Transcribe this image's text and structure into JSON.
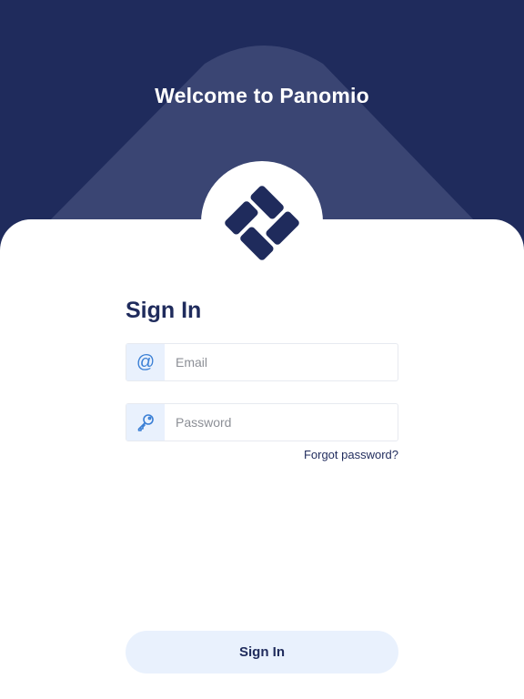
{
  "header": {
    "title": "Welcome to Panomio"
  },
  "logo": {
    "icon": "panomio-logo-icon"
  },
  "form": {
    "heading": "Sign In",
    "email": {
      "icon": "at-sign-icon",
      "icon_glyph": "@",
      "placeholder": "Email",
      "value": ""
    },
    "password": {
      "icon": "key-icon",
      "placeholder": "Password",
      "value": ""
    },
    "forgot_label": "Forgot password?",
    "submit_label": "Sign In"
  },
  "colors": {
    "brand_dark": "#1f2b5c",
    "beam": "#3a4573",
    "accent": "#3a7fd5",
    "button_bg": "#e9f1fd"
  }
}
